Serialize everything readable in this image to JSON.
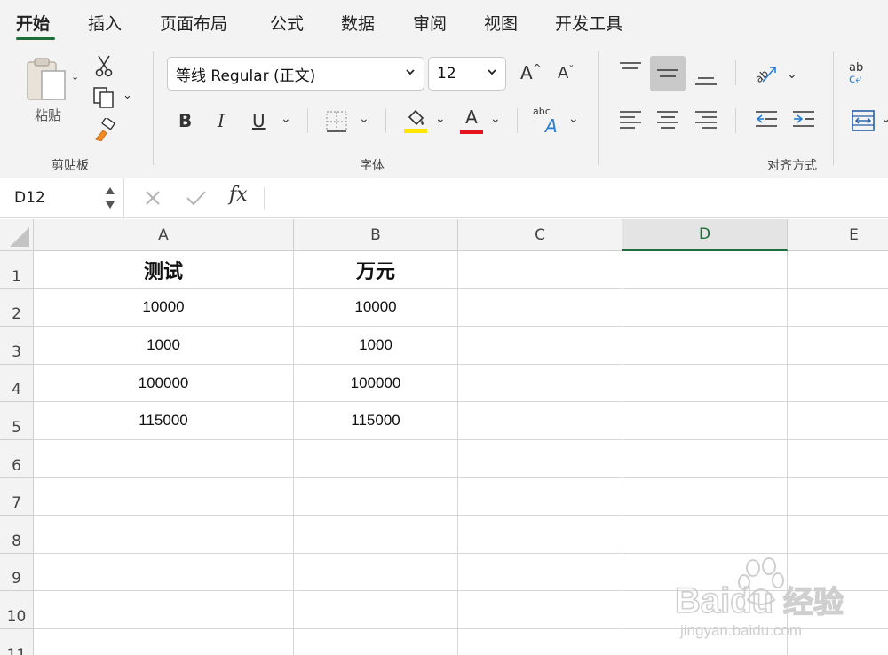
{
  "tabs": [
    {
      "label": "开始",
      "active": true
    },
    {
      "label": "插入"
    },
    {
      "label": "页面布局"
    },
    {
      "label": "公式"
    },
    {
      "label": "数据"
    },
    {
      "label": "审阅"
    },
    {
      "label": "视图"
    },
    {
      "label": "开发工具"
    }
  ],
  "ribbon": {
    "clipboard": {
      "label": "剪贴板",
      "paste_label": "粘贴"
    },
    "font": {
      "label": "字体",
      "font_name": "等线 Regular (正文)",
      "font_size": "12",
      "bold": "B",
      "italic": "I",
      "underline": "U",
      "grow": "A",
      "shrink": "A",
      "font_color_letter": "A",
      "orientation_text": "abc",
      "highlight_color": "#ffe600",
      "font_color": "#e5141c"
    },
    "alignment": {
      "label": "对齐方式",
      "wrap_text": "ab"
    }
  },
  "formula_bar": {
    "name_box": "D12",
    "fx": "fx",
    "formula": ""
  },
  "grid": {
    "columns": [
      "A",
      "B",
      "C",
      "D",
      "E"
    ],
    "selected_column": "D",
    "rows": [
      "1",
      "2",
      "3",
      "4",
      "5",
      "6",
      "7",
      "8",
      "9",
      "10",
      "11"
    ],
    "cells": [
      [
        "测试",
        "万元",
        "",
        "",
        ""
      ],
      [
        "10000",
        "10000",
        "",
        "",
        ""
      ],
      [
        "1000",
        "1000",
        "",
        "",
        ""
      ],
      [
        "100000",
        "100000",
        "",
        "",
        ""
      ],
      [
        "115000",
        "115000",
        "",
        "",
        ""
      ],
      [
        "",
        "",
        "",
        "",
        ""
      ],
      [
        "",
        "",
        "",
        "",
        ""
      ],
      [
        "",
        "",
        "",
        "",
        ""
      ],
      [
        "",
        "",
        "",
        "",
        ""
      ],
      [
        "",
        "",
        "",
        "",
        ""
      ],
      [
        "",
        "",
        "",
        "",
        ""
      ]
    ]
  },
  "accent_color": "#1e6e3a",
  "watermark": {
    "brand": "Baidu",
    "cn": "经验",
    "url": "jingyan.baidu.com"
  }
}
